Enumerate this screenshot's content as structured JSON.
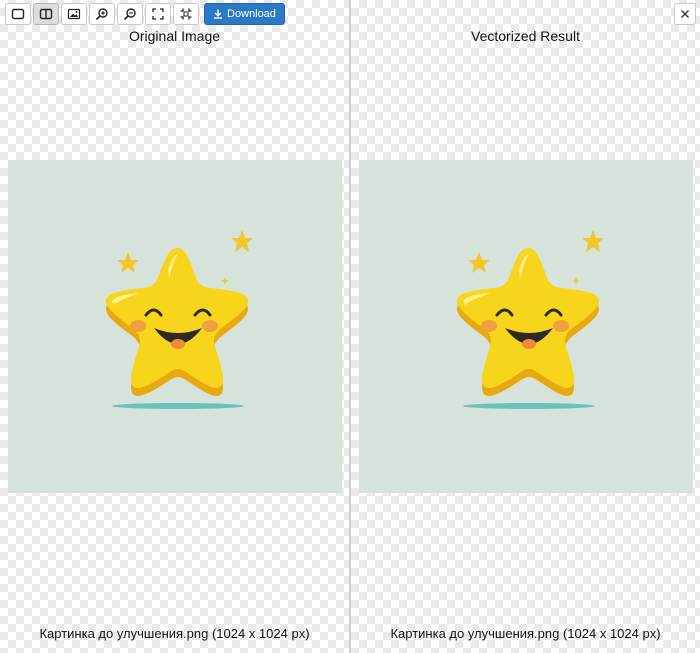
{
  "toolbar": {
    "buttons": [
      {
        "icon": "single-view-icon",
        "active": false
      },
      {
        "icon": "split-view-icon",
        "active": true
      },
      {
        "icon": "image-icon",
        "active": false
      },
      {
        "icon": "zoom-in-icon",
        "active": false
      },
      {
        "icon": "zoom-out-icon",
        "active": false
      },
      {
        "icon": "fit-screen-icon",
        "active": false
      },
      {
        "icon": "actual-size-icon",
        "active": false
      }
    ],
    "download_label": "Download",
    "download_icon": "download-icon",
    "close_icon": "close-icon"
  },
  "left_pane": {
    "title": "Original Image",
    "caption": "Картинка до улучшения.png (1024 x 1024 px)"
  },
  "right_pane": {
    "title": "Vectorized Result",
    "caption": "Картинка до улучшения.png (1024 x 1024 px)"
  },
  "colors": {
    "accent": "#2b78c4",
    "image_background": "#d6e3da",
    "star_fill": "#f7d51d",
    "star_shadow": "#e8a90e",
    "cheek": "#f0a040",
    "mouth": "#2e2a22",
    "shadow_line": "#6cc0bd"
  }
}
